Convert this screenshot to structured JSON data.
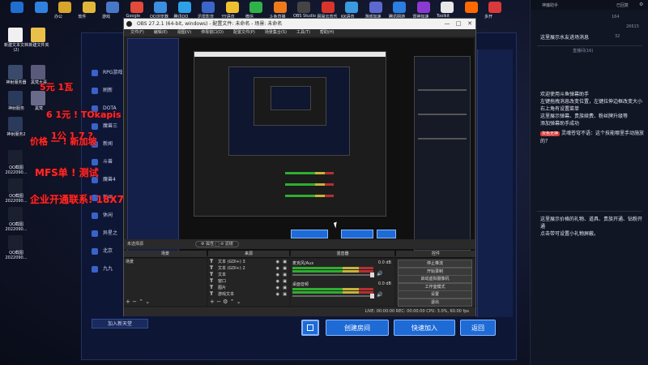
{
  "taskbar": {
    "icons": [
      {
        "label": "",
        "color": "#1f6fd0"
      },
      {
        "label": "",
        "color": "#2f83e0"
      },
      {
        "label": "办公",
        "color": "#d9a52a"
      },
      {
        "label": "软件",
        "color": "#e0b73a"
      },
      {
        "label": "游戏",
        "color": "#4778c8"
      },
      {
        "label": "Google",
        "color": "#e24a3a"
      },
      {
        "label": "QQ浏览器",
        "color": "#3a8fe0"
      },
      {
        "label": "腾讯QQ",
        "color": "#2da0e8"
      },
      {
        "label": "迅雷影音",
        "color": "#3b66c9"
      },
      {
        "label": "YY语音",
        "color": "#f0c030"
      },
      {
        "label": "微信",
        "color": "#2fb24a"
      },
      {
        "label": "斗鱼直播",
        "color": "#f07a1a"
      },
      {
        "label": "OBS Studio",
        "color": "#444"
      },
      {
        "label": "网易云音乐",
        "color": "#d8342c"
      },
      {
        "label": "KK语音",
        "color": "#3b9be0"
      },
      {
        "label": "游戏加速",
        "color": "#5a6ad0"
      },
      {
        "label": "腾讯网游",
        "color": "#2a7de1"
      },
      {
        "label": "雷神加速",
        "color": "#8a3ad0"
      },
      {
        "label": "Toolkit",
        "color": "#e8e8e8"
      },
      {
        "label": "",
        "color": "#ff6a00"
      },
      {
        "label": "多开",
        "color": "#d83a3a"
      }
    ]
  },
  "desktop_icons": [
    {
      "label": "新建文本文档 (2)",
      "color": "#f0f0f0"
    },
    {
      "label": "新建文件夹",
      "color": "#e8c04a"
    },
    {
      "label": "神射服务器",
      "color": "#3a4a6a"
    },
    {
      "label": "黑梵大哥",
      "color": "#5a5a7a"
    },
    {
      "label": "神射服务",
      "color": "#2a3a5a"
    },
    {
      "label": "黑梵",
      "color": "#6a6a8a"
    },
    {
      "label": "神射服务2",
      "color": "#2a3a5a"
    },
    {
      "label": "QQ截图 2022090...",
      "color": "#1b2030"
    },
    {
      "label": "QQ截图 2022090...",
      "color": "#1b2030"
    },
    {
      "label": "QQ截图 2022090...",
      "color": "#1b2030"
    },
    {
      "label": "QQ截图 2022090...",
      "color": "#1b2030"
    }
  ],
  "lobby": {
    "items": [
      "RPG游戏",
      "刷新",
      "DOTA",
      "魔兽三",
      "新闻",
      "斗兽",
      "魔兽4",
      "新闻",
      "休闲",
      "异星之",
      "北京",
      "九九"
    ],
    "overlay_lines": [
      "5元 1瓦",
      "6 1元 ! TOkapis 7788",
      "1公 1 7 ?",
      "价格 一 ! 新加坡",
      "MFS单 ! 测试",
      "企业开通联系! 18X7X38X47"
    ],
    "bottom_buttons": {
      "create": "创建房间",
      "quick": "快速加入",
      "back": "返回"
    },
    "add_friend": "加入新天堂",
    "accent": "#1e6bd6"
  },
  "obs": {
    "title": "OBS 27.2.1 (64-bit, windows) - 配置文件: 未命名 - 场景: 未命名",
    "menu": [
      "文件(F)",
      "编辑(E)",
      "视图(V)",
      "停靠窗口(D)",
      "配置文件(P)",
      "场景集合(S)",
      "工具(T)",
      "帮助(H)"
    ],
    "no_source": "未选择源",
    "properties": "属性",
    "filters": "滤镜",
    "panels": {
      "scenes": "场景",
      "sources": "来源",
      "mixer": "混音器",
      "controls": "控件"
    },
    "scene_item": "场景",
    "sources": [
      "文本 (GDI+) 3",
      "文本 (GDI+) 2",
      "文本",
      "窗口",
      "图片",
      "游戏文本"
    ],
    "mixer": [
      {
        "name": "麦克风/Aux",
        "db": "0.0 dB"
      },
      {
        "name": "桌面音频",
        "db": "0.0 dB"
      }
    ],
    "controls": [
      "停止推流",
      "开始录制",
      "启动虚拟摄像机",
      "工作室模式",
      "设置",
      "退出"
    ],
    "status": "LIVE: 00:00:00   REC: 00:00:00   CPU: 3.0%, 60.00 fps",
    "win_buttons": [
      "—",
      "□",
      "✕"
    ]
  },
  "chat": {
    "header_left": "神魔助手",
    "header_right": "已回复",
    "stats": [
      "164",
      "26615",
      "32"
    ],
    "tab_hint": "直播间(16)",
    "msg1": "这里展示水友进场消息",
    "msg2": "欢迎使用斗鱼弹幕助手\n左键拖拽消息改变位置，左键拉伸边框改变大小\n右上角有设置菜单\n这里展示弹幕、贵族续费、粉丝牌升级等\n添加弹幕助手成功",
    "msg3_badge": "灰色无神",
    "msg3": "灵魂苍穹不语：这个技能哪里手动施放的？",
    "msg4": "这里展示价格的礼物、道具、贵族开通、钻粉开通\n点击带可设置小礼物屏蔽。"
  }
}
